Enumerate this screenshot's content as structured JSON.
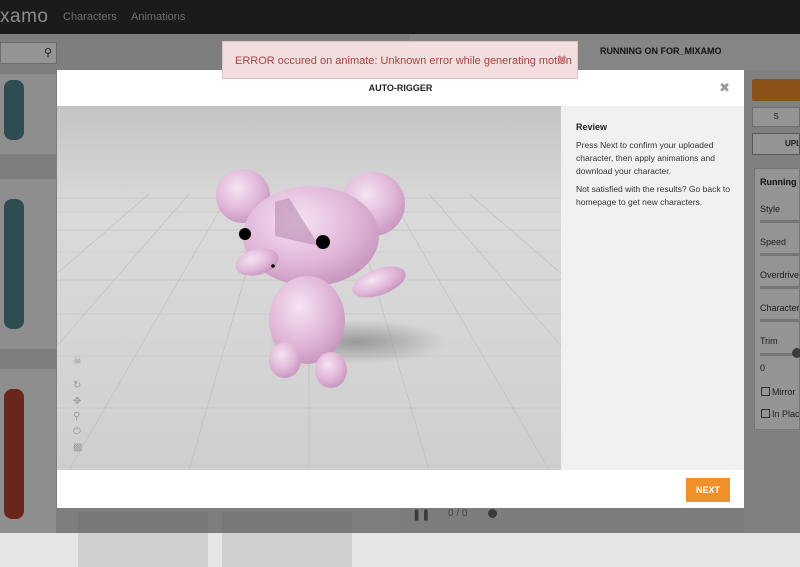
{
  "topbar": {
    "logo": "xamo",
    "nav": [
      "Characters",
      "Animations"
    ]
  },
  "left_panel": {
    "search_placeholder": ""
  },
  "viewer": {
    "frame_counter": "0 / 0"
  },
  "right_panel": {
    "running_on": "RUNNING ON FOR_MIXAMO",
    "secondary_button": "S",
    "upload_button": "UPL",
    "settings_title": "Running",
    "labels": [
      "Style",
      "Speed",
      "Overdrive",
      "Character",
      "Trim"
    ],
    "trim_value": "0",
    "checkboxes": [
      "Mirror",
      "In Place"
    ]
  },
  "toast": {
    "message": "ERROR occured on animate: Unknown error while generating motion"
  },
  "modal": {
    "title": "AUTO-RIGGER",
    "review": {
      "heading": "Review",
      "paragraph1": "Press Next to confirm your uploaded character, then apply animations and download your character.",
      "paragraph2": "Not satisfied with the results? Go back to homepage to get new characters."
    },
    "next_label": "NEXT",
    "viewport_icons": [
      "skull-icon",
      "rotate-icon",
      "move-icon",
      "zoom-icon",
      "power-icon",
      "camera-icon"
    ]
  },
  "colors": {
    "accent": "#f0902b",
    "error_bg": "#f2dede",
    "error_text": "#a94442",
    "topbar": "#2f2f2f"
  }
}
